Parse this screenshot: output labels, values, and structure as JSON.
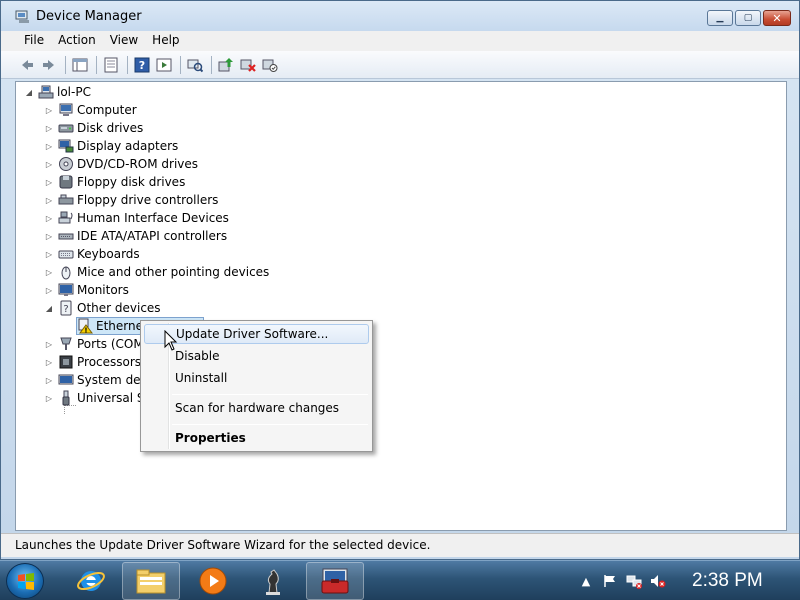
{
  "window": {
    "title": "Device Manager",
    "controls": [
      "minimize",
      "maximize",
      "close"
    ]
  },
  "menu": [
    "File",
    "Action",
    "View",
    "Help"
  ],
  "toolbar": {
    "icons": [
      "back-icon",
      "forward-icon",
      "console-tree-icon",
      "properties-icon",
      "help-icon",
      "action-pane-icon",
      "scan-hardware-icon",
      "update-driver-icon",
      "uninstall-icon",
      "disable-icon"
    ]
  },
  "tree": {
    "root": "lol-PC",
    "categories": [
      {
        "label": "Computer",
        "icon": "computer-icon",
        "expanded": false
      },
      {
        "label": "Disk drives",
        "icon": "disk-icon",
        "expanded": false
      },
      {
        "label": "Display adapters",
        "icon": "display-icon",
        "expanded": false
      },
      {
        "label": "DVD/CD-ROM drives",
        "icon": "dvd-icon",
        "expanded": false
      },
      {
        "label": "Floppy disk drives",
        "icon": "floppy-icon",
        "expanded": false
      },
      {
        "label": "Floppy drive controllers",
        "icon": "controller-icon",
        "expanded": false
      },
      {
        "label": "Human Interface Devices",
        "icon": "hid-icon",
        "expanded": false
      },
      {
        "label": "IDE ATA/ATAPI controllers",
        "icon": "ide-icon",
        "expanded": false
      },
      {
        "label": "Keyboards",
        "icon": "keyboard-icon",
        "expanded": false
      },
      {
        "label": "Mice and other pointing devices",
        "icon": "mouse-icon",
        "expanded": false
      },
      {
        "label": "Monitors",
        "icon": "monitor-icon",
        "expanded": false
      },
      {
        "label": "Other devices",
        "icon": "other-devices-icon",
        "expanded": true
      },
      {
        "label": "Ethernet",
        "icon": "warning-device-icon",
        "child": true
      },
      {
        "label": "Ports (COM",
        "icon": "ports-icon",
        "expanded": false
      },
      {
        "label": "Processors",
        "icon": "processor-icon",
        "expanded": false
      },
      {
        "label": "System devi",
        "icon": "system-icon",
        "expanded": false
      },
      {
        "label": "Universal Se",
        "icon": "usb-icon",
        "expanded": false
      }
    ]
  },
  "context_menu": {
    "items": [
      {
        "label": "Update Driver Software...",
        "highlighted": true
      },
      {
        "label": "Disable"
      },
      {
        "label": "Uninstall"
      },
      {
        "label": "Scan for hardware changes"
      },
      {
        "label": "Properties",
        "bold": true
      }
    ]
  },
  "status": "Launches the Update Driver Software Wizard for the selected device.",
  "taskbar": {
    "clock": "2:38 PM",
    "apps": [
      "internet-explorer-icon",
      "explorer-icon",
      "media-player-icon",
      "chess-icon",
      "device-manager-icon"
    ],
    "tray": [
      "show-hidden-icon",
      "action-center-flag-icon",
      "network-icon",
      "volume-muted-icon"
    ]
  }
}
